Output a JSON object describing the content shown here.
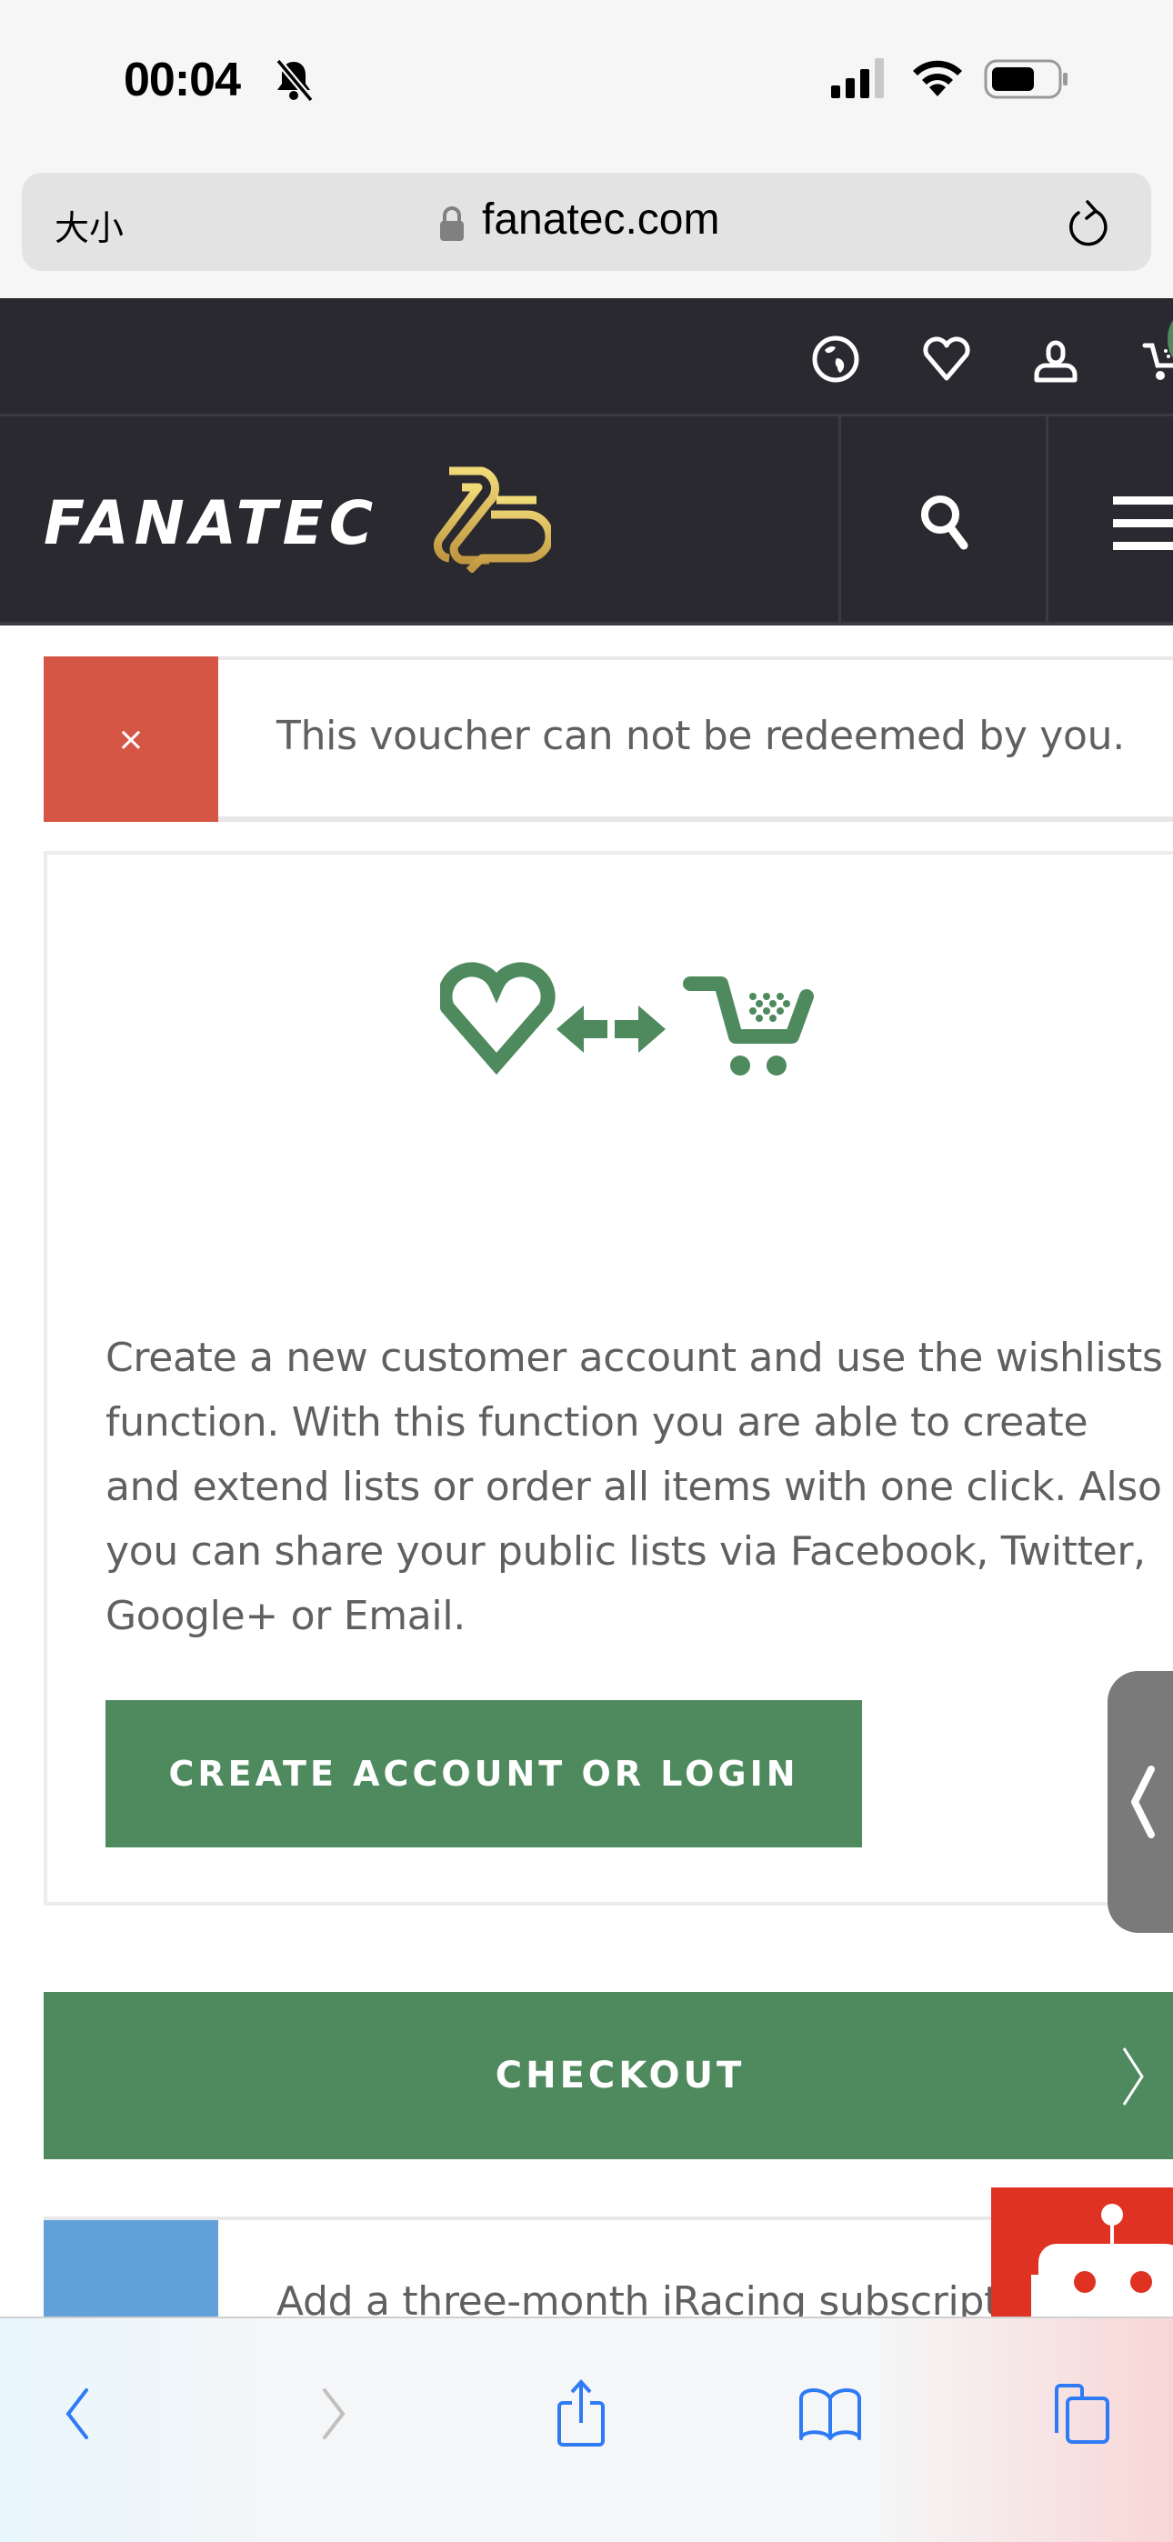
{
  "status_bar": {
    "time": "00:04",
    "icons": [
      "bell-slash-icon",
      "cellular-signal-icon",
      "wifi-icon",
      "battery-icon"
    ]
  },
  "browser": {
    "text_size_label": "大小",
    "url": "fanatec.com",
    "icons": [
      "lock-icon",
      "reload-icon"
    ]
  },
  "header": {
    "top_icons": [
      "globe-icon",
      "heart-icon",
      "user-icon",
      "cart-icon"
    ],
    "logo_text": "FANATEC",
    "logo_badge": "25",
    "nav_icons": [
      "search-icon",
      "hamburger-menu-icon"
    ]
  },
  "alert": {
    "icon": "close-icon",
    "icon_glyph": "×",
    "message": "This voucher can not be redeemed by you.",
    "color": "#d55645"
  },
  "wishlist_card": {
    "illustration": [
      "heart-icon",
      "arrow-left-icon",
      "arrow-right-icon",
      "cart-icon"
    ],
    "description": "Create a new customer account and use the wishlists function. With this function you are able to create and extend lists or order all items with one click. Also you can share your public lists via Facebook, Twitter, Google+ or Email.",
    "button_label": "CREATE ACCOUNT OR LOGIN"
  },
  "checkout": {
    "label": "CHECKOUT",
    "color": "#4f8a5e"
  },
  "info_notice": {
    "message": "Add a three-month iRacing subscription",
    "color": "#61a0d8"
  },
  "chat_widget": {
    "icon": "robot-icon",
    "color": "#e03222"
  },
  "toolbar": {
    "buttons": [
      "back",
      "forward",
      "share",
      "bookmarks",
      "tabs"
    ],
    "accent_color": "#2f7bf5"
  },
  "colors": {
    "header_bg": "#2a2930",
    "brand_green": "#4f8a5e",
    "gold": "#d4ad4a"
  }
}
